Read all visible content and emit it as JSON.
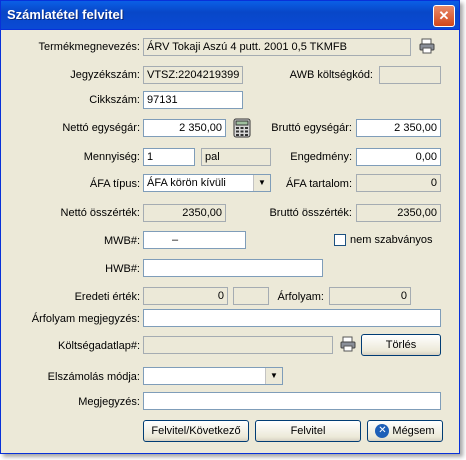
{
  "window": {
    "title": "Számlatétel felvitel",
    "close_glyph": "✕"
  },
  "labels": {
    "termek": "Termékmegnevezés:",
    "jegyzek": "Jegyzékszám:",
    "awb": "AWB költségkód:",
    "cikkszam": "Cikkszám:",
    "netto_egyseg": "Nettó egységár:",
    "brutto_egyseg": "Bruttó egységár:",
    "mennyiseg": "Mennyiség:",
    "engedmeny": "Engedmény:",
    "afa_tipus": "ÁFA típus:",
    "afa_tartalom": "ÁFA tartalom:",
    "netto_osszertek": "Nettó összérték:",
    "brutto_osszertek": "Bruttó összérték:",
    "mwb": "MWB#:",
    "nem_szabvanyos": "nem szabványos",
    "hwb": "HWB#:",
    "eredeti_ertek": "Eredeti érték:",
    "arfolyam": "Árfolyam:",
    "arfolyam_megj": "Árfolyam megjegyzés:",
    "koltsegadatlap": "Költségadatlap#:",
    "elszamolas": "Elszámolás módja:",
    "megjegyzes": "Megjegyzés:"
  },
  "values": {
    "termek": "ÁRV Tokaji Aszú 4 putt. 2001 0,5 TKMFB",
    "jegyzek": "VTSZ:2204219399",
    "awb": "",
    "cikkszam": "97131",
    "netto_egyseg": "2 350,00",
    "brutto_egyseg": "2 350,00",
    "mennyiseg": "1",
    "mennyiseg_unit": "pal",
    "engedmeny": "0,00",
    "afa_tipus": "ÁFA körön kívüli",
    "afa_tartalom": "0",
    "netto_osszertek": "2350,00",
    "brutto_osszertek": "2350,00",
    "mwb": "–",
    "hwb": "",
    "eredeti_ertek": "0",
    "eredeti_currency": "",
    "arfolyam": "0",
    "arfolyam_megj": "",
    "koltsegadatlap": "",
    "elszamolas": "",
    "megjegyzes": ""
  },
  "buttons": {
    "felvitel_kovetkezo": "Felvitel/Következő",
    "felvitel": "Felvitel",
    "megsem": "Mégsem",
    "torles": "Törlés"
  },
  "icons": {
    "printer": "printer-icon",
    "calculator": "calculator-icon",
    "cancel": "cancel-x-icon"
  },
  "colors": {
    "titlebar": "#0a4ad5",
    "dialog_bg": "#ece9d8",
    "close": "#d2461a"
  }
}
